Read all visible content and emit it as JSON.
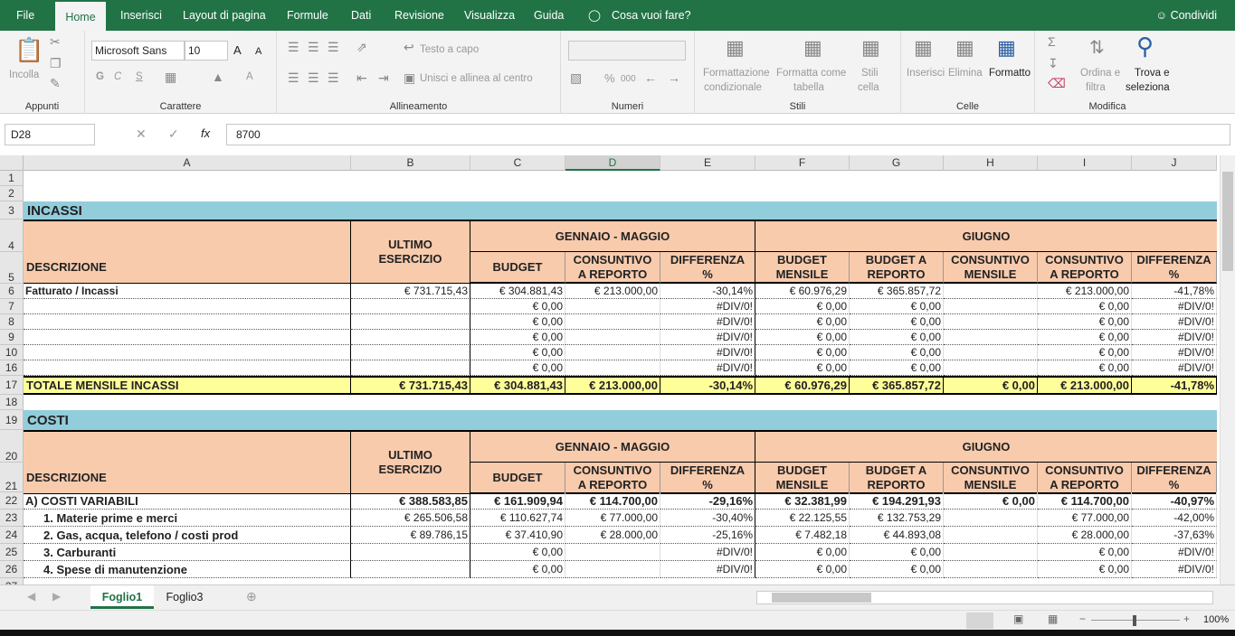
{
  "tabs": [
    "File",
    "Home",
    "Inserisci",
    "Layout di pagina",
    "Formule",
    "Dati",
    "Revisione",
    "Visualizza",
    "Guida",
    "Cosa vuoi fare?"
  ],
  "share": "Condividi",
  "ribbon": {
    "appunti": {
      "label": "Appunti",
      "incolla": "Incolla"
    },
    "carattere": {
      "label": "Carattere",
      "font": "Microsoft Sans",
      "size": "10",
      "bold": "G",
      "italic": "C",
      "under": "S",
      "grow": "A",
      "shrink": "A"
    },
    "allineamento": {
      "label": "Allineamento",
      "wrap": "Testo a capo",
      "merge": "Unisci e allinea al centro"
    },
    "numeri": {
      "label": "Numeri",
      "pct": "%",
      "thousand": "000"
    },
    "stili": {
      "label": "Stili",
      "cond": [
        "Formattazione",
        "condizionale"
      ],
      "table": [
        "Formatta come",
        "tabella"
      ],
      "cellstyle": [
        "Stili",
        "cella"
      ]
    },
    "celle": {
      "label": "Celle",
      "ins": "Inserisci",
      "del": "Elimina",
      "fmt": "Formatto"
    },
    "modifica": {
      "label": "Modifica",
      "sort": [
        "Ordina e",
        "filtra"
      ],
      "find": [
        "Trova e",
        "seleziona"
      ]
    }
  },
  "formula": {
    "namebox": "D28",
    "fx": "fx",
    "value": "8700"
  },
  "columns": [
    "A",
    "B",
    "C",
    "D",
    "E",
    "F",
    "G",
    "H",
    "I",
    "J"
  ],
  "rownums": [
    "1",
    "2",
    "3",
    "4",
    "5",
    "6",
    "7",
    "8",
    "9",
    "10",
    "16",
    "17",
    "18",
    "19",
    "20",
    "21",
    "22",
    "23",
    "24",
    "25",
    "26",
    "27"
  ],
  "incassi": {
    "title": "INCASSI",
    "desc": "DESCRIZIONE",
    "ultimo": [
      "ULTIMO",
      "ESERCIZIO"
    ],
    "gen": "GENNAIO - MAGGIO",
    "giu": "GIUGNO",
    "sub": [
      [
        "BUDGET",
        ""
      ],
      [
        "CONSUNTIVO",
        "A REPORTO"
      ],
      [
        "DIFFERENZA",
        "%"
      ],
      [
        "BUDGET",
        "MENSILE"
      ],
      [
        "BUDGET A",
        "REPORTO"
      ],
      [
        "CONSUNTIVO",
        "MENSILE"
      ],
      [
        "CONSUNTIVO",
        "A REPORTO"
      ],
      [
        "DIFFERENZA",
        "%"
      ]
    ],
    "rows": [
      [
        "Fatturato / Incassi",
        "€ 731.715,43",
        "€ 304.881,43",
        "€ 213.000,00",
        "-30,14%",
        "€ 60.976,29",
        "€ 365.857,72",
        "",
        "€ 213.000,00",
        "-41,78%"
      ],
      [
        "",
        "",
        "€ 0,00",
        "",
        "#DIV/0!",
        "€ 0,00",
        "€ 0,00",
        "",
        "€ 0,00",
        "#DIV/0!"
      ],
      [
        "",
        "",
        "€ 0,00",
        "",
        "#DIV/0!",
        "€ 0,00",
        "€ 0,00",
        "",
        "€ 0,00",
        "#DIV/0!"
      ],
      [
        "",
        "",
        "€ 0,00",
        "",
        "#DIV/0!",
        "€ 0,00",
        "€ 0,00",
        "",
        "€ 0,00",
        "#DIV/0!"
      ],
      [
        "",
        "",
        "€ 0,00",
        "",
        "#DIV/0!",
        "€ 0,00",
        "€ 0,00",
        "",
        "€ 0,00",
        "#DIV/0!"
      ],
      [
        "",
        "",
        "€ 0,00",
        "",
        "#DIV/0!",
        "€ 0,00",
        "€ 0,00",
        "",
        "€ 0,00",
        "#DIV/0!"
      ]
    ],
    "total": [
      "TOTALE MENSILE INCASSI",
      "€ 731.715,43",
      "€ 304.881,43",
      "€ 213.000,00",
      "-30,14%",
      "€ 60.976,29",
      "€ 365.857,72",
      "€ 0,00",
      "€ 213.000,00",
      "-41,78%"
    ]
  },
  "costi": {
    "title": "COSTI",
    "rows": [
      [
        "A) COSTI VARIABILI",
        "€ 388.583,85",
        "€ 161.909,94",
        "€ 114.700,00",
        "-29,16%",
        "€ 32.381,99",
        "€ 194.291,93",
        "€ 0,00",
        "€ 114.700,00",
        "-40,97%"
      ],
      [
        "1. Materie prime e merci",
        "€ 265.506,58",
        "€ 110.627,74",
        "€ 77.000,00",
        "-30,40%",
        "€ 22.125,55",
        "€ 132.753,29",
        "",
        "€ 77.000,00",
        "-42,00%"
      ],
      [
        "2. Gas, acqua, telefono / costi prod",
        "€ 89.786,15",
        "€ 37.410,90",
        "€ 28.000,00",
        "-25,16%",
        "€ 7.482,18",
        "€ 44.893,08",
        "",
        "€ 28.000,00",
        "-37,63%"
      ],
      [
        "3. Carburanti",
        "",
        "€ 0,00",
        "",
        "#DIV/0!",
        "€ 0,00",
        "€ 0,00",
        "",
        "€ 0,00",
        "#DIV/0!"
      ],
      [
        "4. Spese di manutenzione",
        "",
        "€ 0,00",
        "",
        "#DIV/0!",
        "€ 0,00",
        "€ 0,00",
        "",
        "€ 0,00",
        "#DIV/0!"
      ]
    ]
  },
  "sheets": [
    "Foglio1",
    "Foglio3"
  ],
  "zoom": "100%"
}
